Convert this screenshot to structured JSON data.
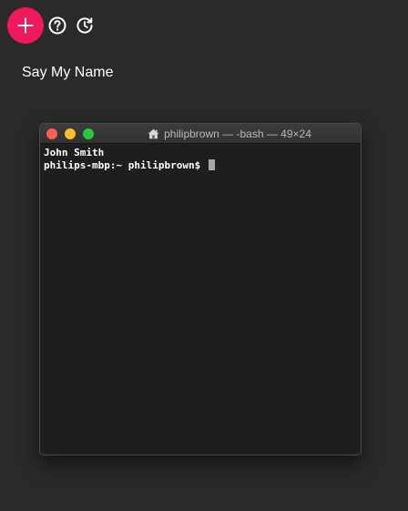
{
  "toolbar": {
    "add_button": {
      "icon": "plus-icon",
      "color": "#f0195c"
    },
    "help_button": {
      "icon": "help-circle-icon"
    },
    "history_button": {
      "icon": "history-icon"
    }
  },
  "page": {
    "title": "Say My Name"
  },
  "terminal": {
    "title": "philipbrown — -bash — 49×24",
    "title_icon": "home-icon",
    "lines": [
      "John Smith",
      "philips-mbp:~ philipbrown$ "
    ]
  }
}
